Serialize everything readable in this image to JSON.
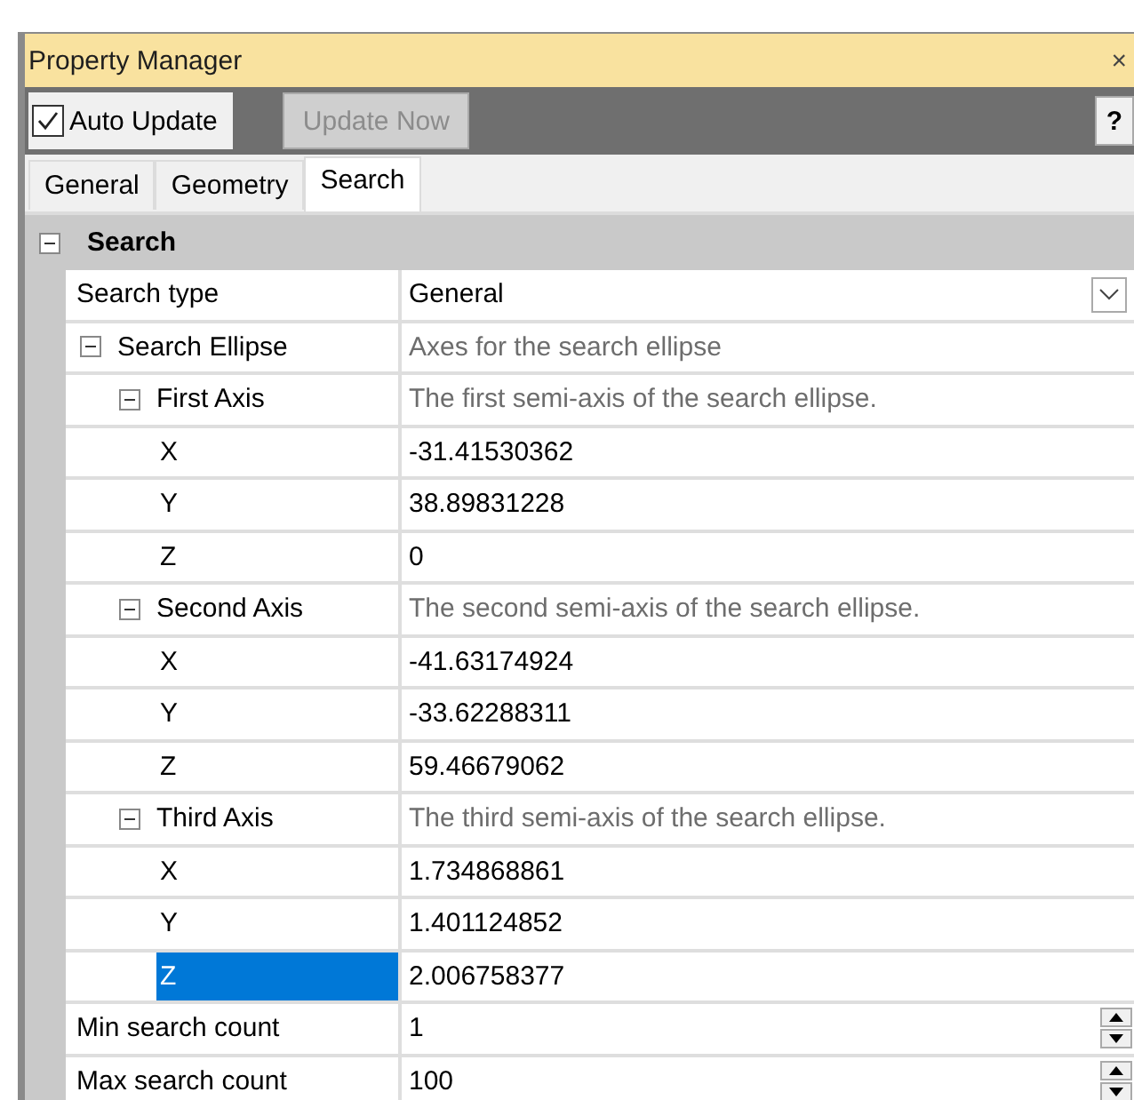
{
  "window": {
    "title": "Property Manager",
    "close_label": "×"
  },
  "toolbar": {
    "auto_update": {
      "label": "Auto Update",
      "checked": true
    },
    "update_now": {
      "label": "Update Now",
      "disabled": true
    },
    "help_label": "?"
  },
  "tabs": [
    {
      "label": "General",
      "selected": false
    },
    {
      "label": "Geometry",
      "selected": false
    },
    {
      "label": "Search",
      "selected": true
    }
  ],
  "section": {
    "title": "Search",
    "expanded": true
  },
  "properties": [
    {
      "kind": "dropdown",
      "name": "Search type",
      "value": "General",
      "selected": false
    },
    {
      "kind": "group",
      "name": "Search Ellipse",
      "value": "Axes for the search ellipse",
      "expanded": true,
      "selected": false,
      "children": [
        {
          "kind": "group",
          "name": "First Axis",
          "value": "The first semi-axis of the search ellipse.",
          "expanded": true,
          "selected": false,
          "children": [
            {
              "kind": "text",
              "name": "X",
              "value": "-31.41530362",
              "selected": false
            },
            {
              "kind": "text",
              "name": "Y",
              "value": "38.89831228",
              "selected": false
            },
            {
              "kind": "text",
              "name": "Z",
              "value": "0",
              "selected": false
            }
          ]
        },
        {
          "kind": "group",
          "name": "Second Axis",
          "value": "The second semi-axis of the search ellipse.",
          "expanded": true,
          "selected": false,
          "children": [
            {
              "kind": "text",
              "name": "X",
              "value": "-41.63174924",
              "selected": false
            },
            {
              "kind": "text",
              "name": "Y",
              "value": "-33.62288311",
              "selected": false
            },
            {
              "kind": "text",
              "name": "Z",
              "value": "59.46679062",
              "selected": false
            }
          ]
        },
        {
          "kind": "group",
          "name": "Third Axis",
          "value": "The third semi-axis of the search ellipse.",
          "expanded": true,
          "selected": false,
          "children": [
            {
              "kind": "text",
              "name": "X",
              "value": "1.734868861",
              "selected": false
            },
            {
              "kind": "text",
              "name": "Y",
              "value": "1.401124852",
              "selected": false
            },
            {
              "kind": "text",
              "name": "Z",
              "value": "2.006758377",
              "selected": true
            }
          ]
        }
      ]
    },
    {
      "kind": "spinner",
      "name": "Min search count",
      "value": "1",
      "selected": false
    },
    {
      "kind": "spinner",
      "name": "Max search count",
      "value": "100",
      "selected": false
    }
  ]
}
